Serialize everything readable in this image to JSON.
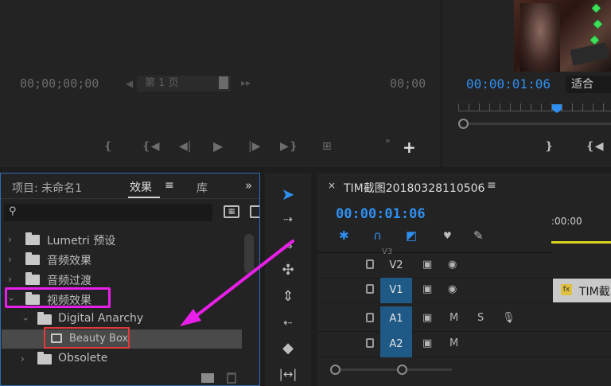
{
  "source_monitor": {
    "timecode_left": "00;00;00;00",
    "page_field": "第 1 页",
    "timecode_right": "00;00"
  },
  "program_monitor": {
    "timecode": "00:00:01:06",
    "fit_select": "适合"
  },
  "effects_panel": {
    "project_tab": "项目: 未命名1",
    "effects_tab": "效果",
    "library_tab": "库",
    "search_placeholder": "",
    "tree": [
      {
        "label": "Lumetri 预设"
      },
      {
        "label": "音频效果"
      },
      {
        "label": "音频过渡"
      },
      {
        "label": "视频效果"
      },
      {
        "label": "Digital Anarchy"
      },
      {
        "label": "Beauty Box"
      },
      {
        "label": "Obsolete"
      }
    ]
  },
  "timeline": {
    "sequence_name": "TIM截图20180328110506",
    "timecode": "00:00:01:06",
    "ruler_time": ":00:00",
    "tracks": [
      {
        "label": "V2"
      },
      {
        "label": "V1"
      },
      {
        "label": "A1",
        "m": "M",
        "s": "S"
      },
      {
        "label": "A2",
        "m": "M"
      }
    ],
    "clip_label": "TIM截"
  },
  "colors": {
    "accent_blue": "#2f8ff0",
    "highlight_magenta": "#e81fe8",
    "highlight_red": "#e03a3a",
    "timeline_yellow": "#d9d51a"
  }
}
